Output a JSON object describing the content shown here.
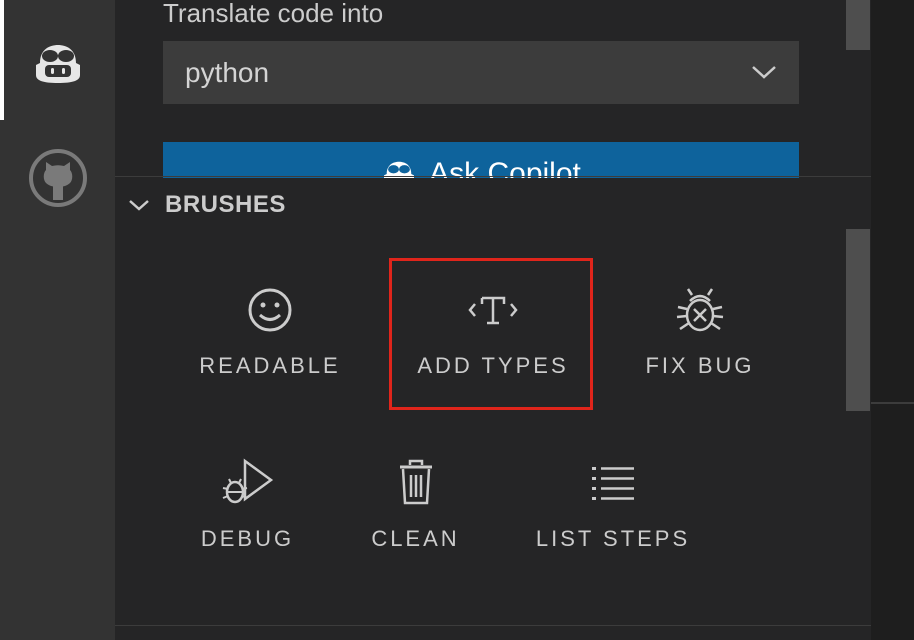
{
  "translate": {
    "label": "Translate code into",
    "selected_language": "python"
  },
  "ask_button": {
    "label": "Ask Copilot"
  },
  "brushes": {
    "title": "BRUSHES",
    "items": [
      {
        "label": "READABLE",
        "icon": "smiley-icon"
      },
      {
        "label": "ADD TYPES",
        "icon": "type-bracket-icon"
      },
      {
        "label": "FIX BUG",
        "icon": "bug-icon"
      },
      {
        "label": "DEBUG",
        "icon": "debug-icon"
      },
      {
        "label": "CLEAN",
        "icon": "trash-icon"
      },
      {
        "label": "LIST STEPS",
        "icon": "list-icon"
      }
    ],
    "highlighted": "ADD TYPES"
  },
  "activity_bar": {
    "items": [
      {
        "icon": "copilot-icon",
        "active": true
      },
      {
        "icon": "github-icon",
        "active": false
      }
    ]
  },
  "colors": {
    "highlight": "#e0251b",
    "button": "#0e639c",
    "sidebar": "#252526",
    "activity_bar": "#333333"
  }
}
